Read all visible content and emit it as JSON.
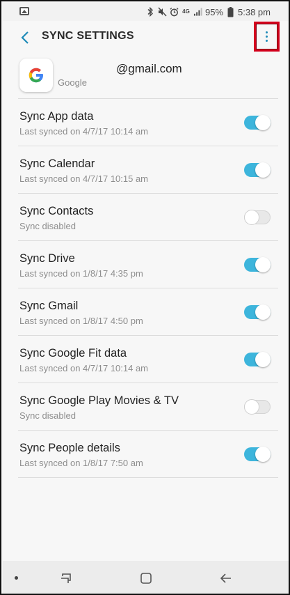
{
  "status_bar": {
    "network": "4G",
    "battery": "95%",
    "time": "5:38 pm"
  },
  "header": {
    "title": "SYNC SETTINGS",
    "back_icon": "chevron-left-icon",
    "more_icon": "more-vertical-icon"
  },
  "account": {
    "email": "@gmail.com",
    "type": "Google",
    "icon": "google-logo"
  },
  "sync_items": [
    {
      "title": "Sync App data",
      "subtitle": "Last synced on 4/7/17  10:14 am",
      "enabled": true
    },
    {
      "title": "Sync Calendar",
      "subtitle": "Last synced on 4/7/17  10:15 am",
      "enabled": true
    },
    {
      "title": "Sync Contacts",
      "subtitle": "Sync disabled",
      "enabled": false
    },
    {
      "title": "Sync Drive",
      "subtitle": "Last synced on 1/8/17  4:35 pm",
      "enabled": true
    },
    {
      "title": "Sync Gmail",
      "subtitle": "Last synced on 1/8/17  4:50 pm",
      "enabled": true
    },
    {
      "title": "Sync Google Fit data",
      "subtitle": "Last synced on 4/7/17  10:14 am",
      "enabled": true
    },
    {
      "title": "Sync Google Play Movies & TV",
      "subtitle": "Sync disabled",
      "enabled": false
    },
    {
      "title": "Sync People details",
      "subtitle": "Last synced on 1/8/17  7:50 am",
      "enabled": true
    }
  ],
  "colors": {
    "accent": "#3db5dc",
    "highlight_box": "#d3001c"
  },
  "navbar": {
    "icons": [
      "dot-icon",
      "recent-apps-icon",
      "home-icon",
      "back-arrow-icon"
    ]
  }
}
